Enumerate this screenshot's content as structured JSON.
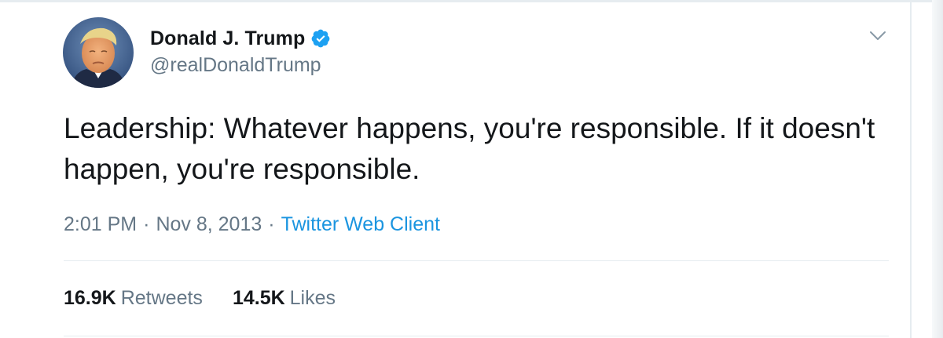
{
  "author": {
    "display_name": "Donald J. Trump",
    "handle": "@realDonaldTrump",
    "verified": true,
    "avatar_icon": "profile-photo-avatar"
  },
  "tweet": {
    "text": "Leadership: Whatever happens, you're responsible. If it doesn't happen, you're responsible.",
    "time": "2:01 PM",
    "date": "Nov 8, 2013",
    "separator": "·",
    "client": "Twitter Web Client"
  },
  "stats": {
    "retweets_count": "16.9K",
    "retweets_label": "Retweets",
    "likes_count": "14.5K",
    "likes_label": "Likes"
  },
  "icons": {
    "verified": "verified-badge-icon",
    "menu": "chevron-down-icon"
  },
  "colors": {
    "text_primary": "#14171a",
    "text_secondary": "#657786",
    "link": "#1b95e0",
    "verified_blue": "#1da1f2",
    "divider": "#e6ecf0"
  }
}
